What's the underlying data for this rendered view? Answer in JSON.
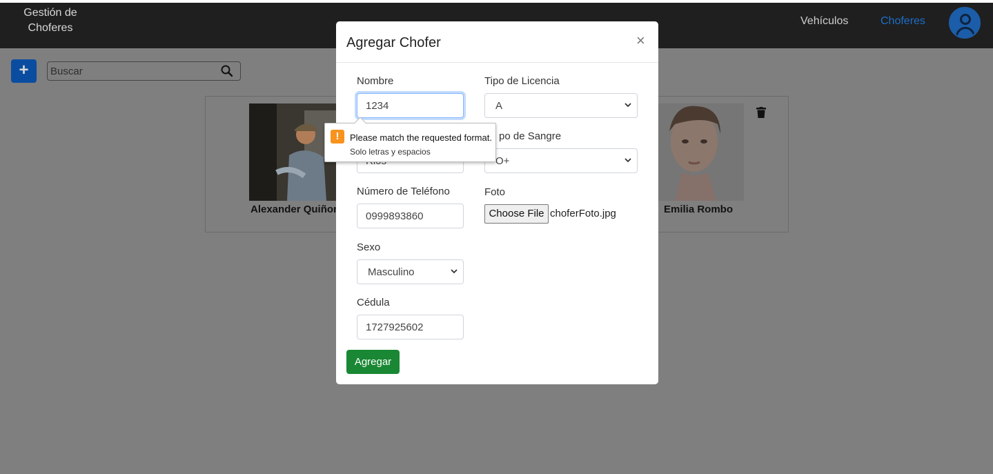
{
  "navbar": {
    "brand": "Gestión de Choferes",
    "links": [
      "Vehículos",
      "Choferes"
    ],
    "active_color": "#1d6ec9"
  },
  "toolbar": {
    "add_label": "+",
    "search_placeholder": "Buscar"
  },
  "cards": [
    {
      "name": "Alexander Quiñon"
    },
    {
      "name": "Emilia Rombo"
    }
  ],
  "modal": {
    "title": "Agregar Chofer",
    "close_label": "×",
    "fields": {
      "nombre": {
        "label": "Nombre",
        "value": "1234"
      },
      "apellido": {
        "value": "Rios"
      },
      "telefono": {
        "label": "Número de Teléfono",
        "value": "0999893860"
      },
      "sexo": {
        "label": "Sexo",
        "value": "Masculino"
      },
      "cedula": {
        "label": "Cédula",
        "value": "1727925602"
      },
      "licencia": {
        "label": "Tipo de Licencia",
        "value": "A"
      },
      "sangre": {
        "label": "po de Sangre",
        "value": "O+"
      },
      "foto": {
        "label": "Foto",
        "button": "Choose File",
        "filename": "choferFoto.jpg"
      }
    },
    "submit_label": "Agregar",
    "submit_color": "#198733"
  },
  "validation": {
    "message": "Please match the requested format.",
    "detail": "Solo letras y espacios",
    "icon": "!"
  }
}
